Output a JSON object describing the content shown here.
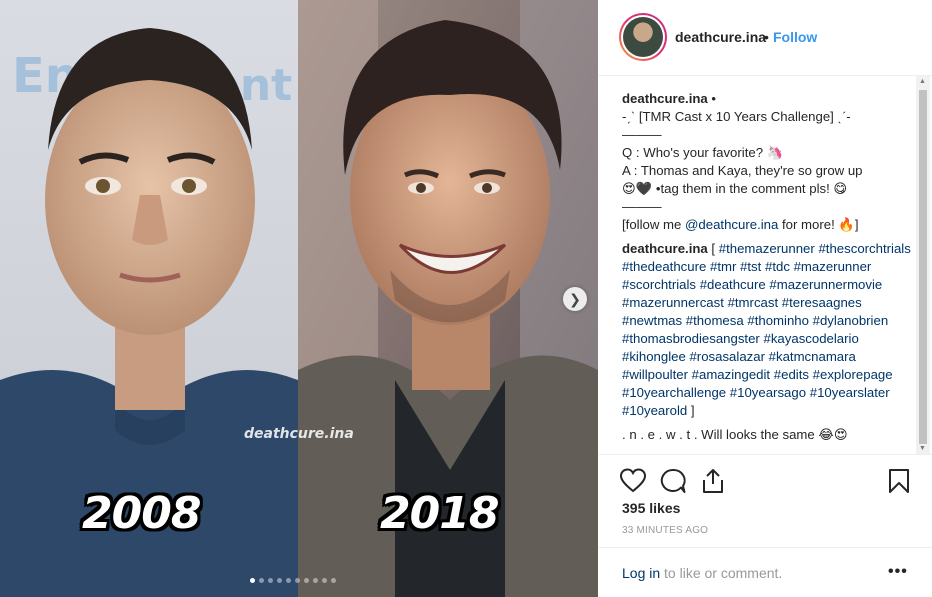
{
  "post": {
    "years": [
      "2008",
      "2018"
    ],
    "watermark": "deathcure.ina",
    "carousel": {
      "count": 10,
      "active_index": 0
    }
  },
  "header": {
    "username": "deathcure.ina",
    "separator": "•",
    "follow_label": "Follow"
  },
  "caption": {
    "username": "deathcure.ina",
    "username_suffix": " •",
    "line1": "-ˏˋ [TMR Cast x 10 Years Challenge] ˎˊ-",
    "divider": "———",
    "q_line": "Q : Who's your favorite? 🦄",
    "a_line1": "A : Thomas and Kaya, they're so grow up",
    "a_line2": "😍🖤 •tag them in the comment pls! 😋",
    "divider2": "———",
    "follow_prefix": "[follow me ",
    "follow_handle": "@deathcure.ina",
    "follow_suffix": " for more! 🔥]",
    "hashtags_user": "deathcure.ina",
    "hashtags_open": " [ ",
    "hashtags": [
      "#themazerunner",
      "#thescorchtrials",
      "#thedeathcure",
      "#tmr",
      "#tst",
      "#tdc",
      "#mazerunner",
      "#scorchtrials",
      "#deathcure",
      "#mazerunnermovie",
      "#mazerunnercast",
      "#tmrcast",
      "#teresaagnes",
      "#newtmas",
      "#thomesa",
      "#thominho",
      "#dylanobrien",
      "#thomasbrodiesangster",
      "#kayascodelario",
      "#kihonglee",
      "#rosasalazar",
      "#katmcnamara",
      "#willpoulter",
      "#amazingedit",
      "#edits",
      "#explorepage",
      "#10yearchallenge",
      "#10yearsago",
      "#10yearslater",
      "#10yearold"
    ],
    "hashtags_close": " ]",
    "comment_preview": ". n . e . w . t . Will looks the same 😂😍"
  },
  "actions": {
    "like_icon": "heart-icon",
    "comment_icon": "comment-icon",
    "share_icon": "share-icon",
    "save_icon": "bookmark-icon"
  },
  "likes": "395 likes",
  "timestamp": "33 MINUTES AGO",
  "footer": {
    "login_link": "Log in",
    "login_text": " to like or comment.",
    "more_label": "•••"
  }
}
